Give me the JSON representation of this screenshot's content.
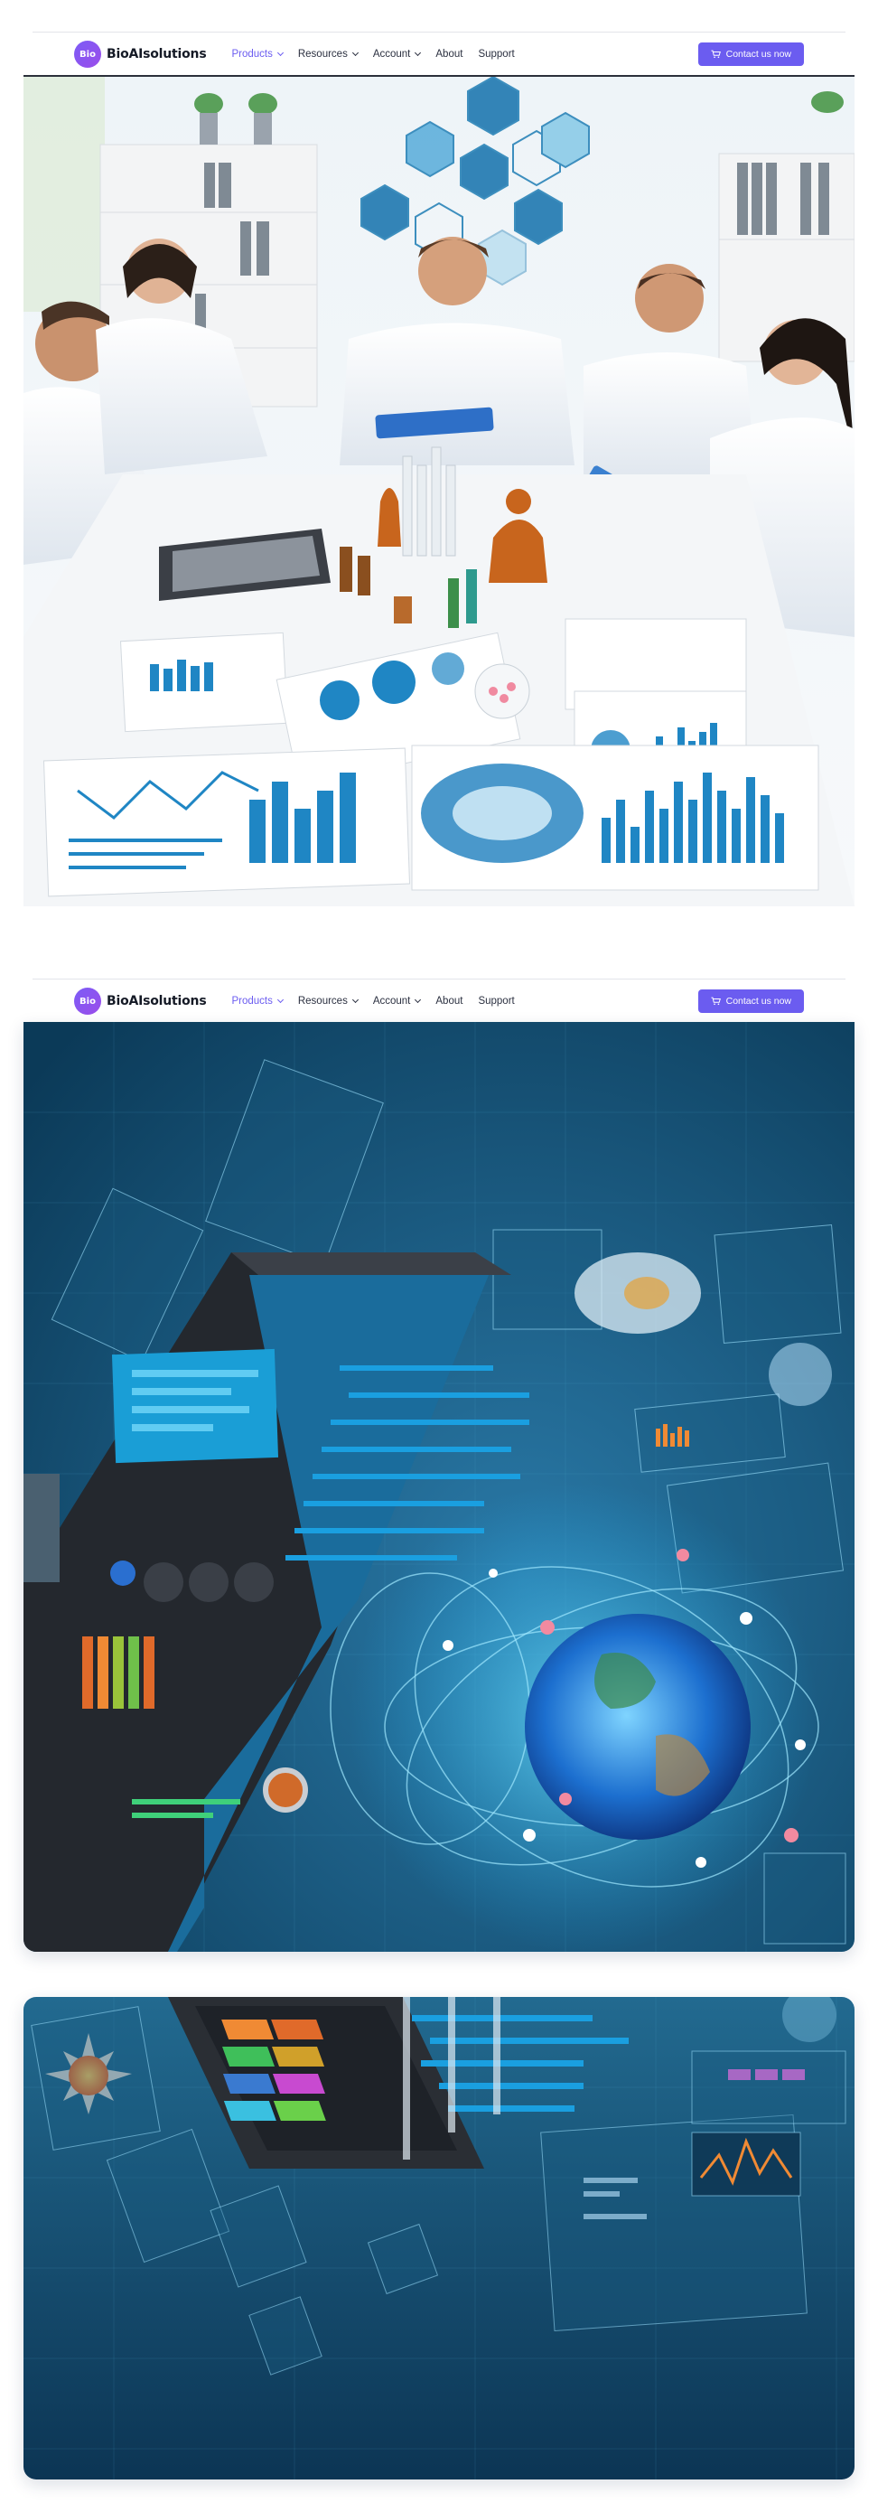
{
  "navbars": [
    {
      "logo": {
        "badge": "Bio",
        "name": "BioAIsolutions"
      },
      "menu": [
        {
          "label": "Products",
          "active": true,
          "dropdown": true
        },
        {
          "label": "Resources",
          "active": false,
          "dropdown": true
        },
        {
          "label": "Account",
          "active": false,
          "dropdown": true
        },
        {
          "label": "About",
          "active": false,
          "dropdown": false
        },
        {
          "label": "Support",
          "active": false,
          "dropdown": false
        }
      ],
      "cta": {
        "label": "Contact us now",
        "icon": "cart-icon"
      }
    },
    {
      "logo": {
        "badge": "Bio",
        "name": "BioAIsolutions"
      },
      "menu": [
        {
          "label": "Products",
          "active": true,
          "dropdown": true
        },
        {
          "label": "Resources",
          "active": false,
          "dropdown": true
        },
        {
          "label": "Account",
          "active": false,
          "dropdown": true
        },
        {
          "label": "About",
          "active": false,
          "dropdown": false
        },
        {
          "label": "Support",
          "active": false,
          "dropdown": false
        }
      ],
      "cta": {
        "label": "Contact us now",
        "icon": "cart-icon"
      }
    }
  ],
  "images": [
    {
      "name": "medical-team-meeting-image",
      "subject": "doctors reviewing charts and medicine bottles at a table"
    },
    {
      "name": "bioinformatics-server-globe-image",
      "subject": "futuristic server hardware with glowing globe and data panels"
    },
    {
      "name": "bioinformatics-dashboard-image",
      "subject": "floating data screens and colorful server modules"
    }
  ],
  "colors": {
    "accent": "#6b5cf0",
    "text": "#2b3040",
    "panel_dark_blue": "#0f3d5e",
    "chart_blue": "#1f86c4"
  }
}
